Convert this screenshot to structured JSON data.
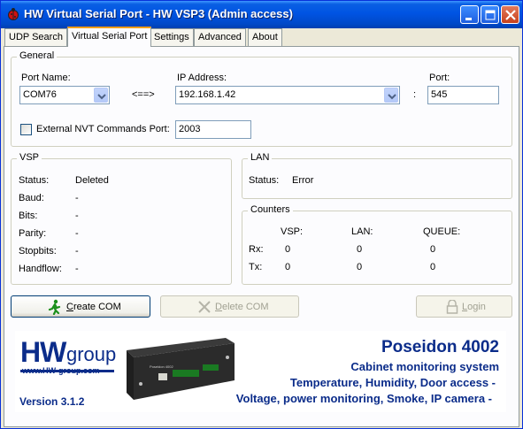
{
  "window": {
    "title": "HW Virtual Serial Port - HW VSP3 (Admin access)",
    "icon": "hw-ladybug-icon"
  },
  "tabs": [
    {
      "label": "UDP Search",
      "active": false
    },
    {
      "label": "Virtual Serial Port",
      "active": true
    },
    {
      "label": "Settings",
      "active": false
    },
    {
      "label": "Advanced",
      "active": false
    },
    {
      "label": "About",
      "active": false
    }
  ],
  "general": {
    "title": "General",
    "port_name_label": "Port Name:",
    "port_name_value": "COM76",
    "arrow": "<==>",
    "ip_label": "IP Address:",
    "ip_value": "192.168.1.42",
    "colon": ":",
    "port_label": "Port:",
    "port_value": "545",
    "nvt_checkbox_label": "External NVT Commands Port:",
    "nvt_checked": false,
    "nvt_port_value": "2003"
  },
  "vsp": {
    "title": "VSP",
    "rows": [
      {
        "label": "Status:",
        "value": "Deleted"
      },
      {
        "label": "Baud:",
        "value": "-"
      },
      {
        "label": "Bits:",
        "value": "-"
      },
      {
        "label": "Parity:",
        "value": "-"
      },
      {
        "label": "Stopbits:",
        "value": "-"
      },
      {
        "label": "Handflow:",
        "value": "-"
      }
    ]
  },
  "lan": {
    "title": "LAN",
    "status_label": "Status:",
    "status_value": "Error"
  },
  "counters": {
    "title": "Counters",
    "headers": [
      "VSP:",
      "LAN:",
      "QUEUE:"
    ],
    "rows": [
      {
        "label": "Rx:",
        "values": [
          "0",
          "0",
          "0"
        ]
      },
      {
        "label": "Tx:",
        "values": [
          "0",
          "0",
          "0"
        ]
      }
    ]
  },
  "buttons": {
    "create": {
      "label": "Create COM",
      "icon": "running-man-icon",
      "enabled": true
    },
    "delete": {
      "label": "Delete COM",
      "icon": "delete-x-icon",
      "enabled": false
    },
    "login": {
      "label": "Login",
      "icon": "lock-icon",
      "enabled": false
    }
  },
  "banner": {
    "logo_hw": "HW",
    "logo_group": "group",
    "logo_url": "www.HW-group.com",
    "version": "Version  3.1.2",
    "product": "Poseidon 4002",
    "line1": "Cabinet monitoring system",
    "line2": "Temperature, Humidity, Door access -",
    "line3": "Voltage, power monitoring, Smoke, IP camera -",
    "device_label": "Poseidon 4002"
  },
  "colors": {
    "titlebar": "#0054e3",
    "tab_active_accent": "#f2a01a",
    "banner_text": "#0b2c8a",
    "group_border": "#d0d0bf"
  }
}
